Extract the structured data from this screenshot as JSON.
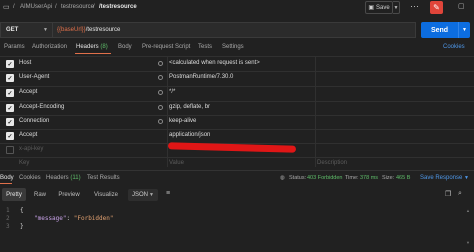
{
  "breadcrumb": {
    "items": [
      "AIMUserApi",
      "testresource",
      "/testresource"
    ],
    "separator": "/"
  },
  "toolbar": {
    "save_label": "Save",
    "dropdown_icon": "chevron-down-icon",
    "edit_icon": "pencil-icon"
  },
  "request": {
    "method": "GET",
    "url_variable": "{{baseUrl}}",
    "url_path": "/testresource",
    "send_label": "Send"
  },
  "request_tabs": [
    {
      "label": "Params"
    },
    {
      "label": "Authorization"
    },
    {
      "label": "Headers",
      "count": "(8)"
    },
    {
      "label": "Body"
    },
    {
      "label": "Pre-request Script"
    },
    {
      "label": "Tests"
    },
    {
      "label": "Settings"
    }
  ],
  "cookies_label": "Cookies",
  "headers": [
    {
      "key": "Host",
      "value": "<calculated when request is sent>",
      "checked": true
    },
    {
      "key": "User-Agent",
      "value": "PostmanRuntime/7.30.0",
      "checked": true
    },
    {
      "key": "Accept",
      "value": "*/*",
      "checked": true
    },
    {
      "key": "Accept-Encoding",
      "value": "gzip, deflate, br",
      "checked": true
    },
    {
      "key": "Connection",
      "value": "keep-alive",
      "checked": true
    },
    {
      "key": "Accept",
      "value": "application/json",
      "checked": true
    },
    {
      "key": "x-api-key",
      "value": "",
      "checked": false
    }
  ],
  "new_row": {
    "key_placeholder": "Key",
    "value_placeholder": "Value",
    "description_placeholder": "Description"
  },
  "response_tabs": [
    {
      "label": "Body"
    },
    {
      "label": "Cookies"
    },
    {
      "label": "Headers",
      "count": "(11)"
    },
    {
      "label": "Test Results"
    }
  ],
  "status": {
    "status_label": "Status:",
    "status_value": "403 Forbidden",
    "time_label": "Time:",
    "time_value": "378 ms",
    "size_label": "Size:",
    "size_value": "465 B"
  },
  "save_response_label": "Save Response",
  "view_buttons": [
    "Pretty",
    "Raw",
    "Preview",
    "Visualize"
  ],
  "format": "JSON",
  "response_body": {
    "line_numbers": [
      "1",
      "2",
      "3"
    ],
    "open": "{",
    "key": "\"message\"",
    "colon": ": ",
    "value": "\"Forbidden\"",
    "close": "}"
  },
  "colors": {
    "accent_orange": "#e0704a",
    "send_blue": "#0c6de0",
    "status_green": "#5fbf6a",
    "link_blue": "#4e97e8",
    "redaction_red": "#e01616"
  }
}
